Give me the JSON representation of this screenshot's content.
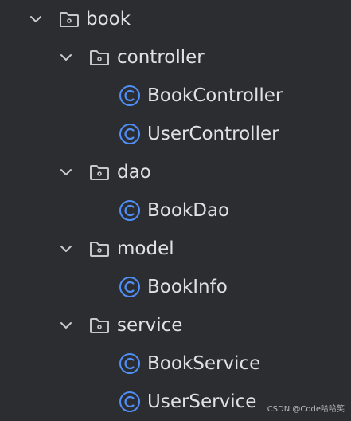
{
  "tree": {
    "root": {
      "label": "book",
      "icon": "folder-icon",
      "expanded": true
    },
    "controller": {
      "label": "controller",
      "icon": "package-folder-icon",
      "expanded": true
    },
    "book_controller": {
      "label": "BookController",
      "icon": "java-class-icon"
    },
    "user_controller": {
      "label": "UserController",
      "icon": "java-class-icon"
    },
    "dao": {
      "label": "dao",
      "icon": "package-folder-icon",
      "expanded": true
    },
    "book_dao": {
      "label": "BookDao",
      "icon": "java-class-icon"
    },
    "model": {
      "label": "model",
      "icon": "package-folder-icon",
      "expanded": true
    },
    "book_info": {
      "label": "BookInfo",
      "icon": "java-class-icon"
    },
    "service": {
      "label": "service",
      "icon": "package-folder-icon",
      "expanded": true
    },
    "book_service": {
      "label": "BookService",
      "icon": "java-class-icon"
    },
    "user_service": {
      "label": "UserService",
      "icon": "java-class-icon"
    }
  },
  "watermark": {
    "text": "CSDN @Code哈哈笑"
  },
  "colors": {
    "background": "#2b2d30",
    "text": "#dfe1e5",
    "chevron": "#c9ccd1",
    "folder_icon": "#c5c8cd",
    "class_icon": "#4f8ff7"
  }
}
